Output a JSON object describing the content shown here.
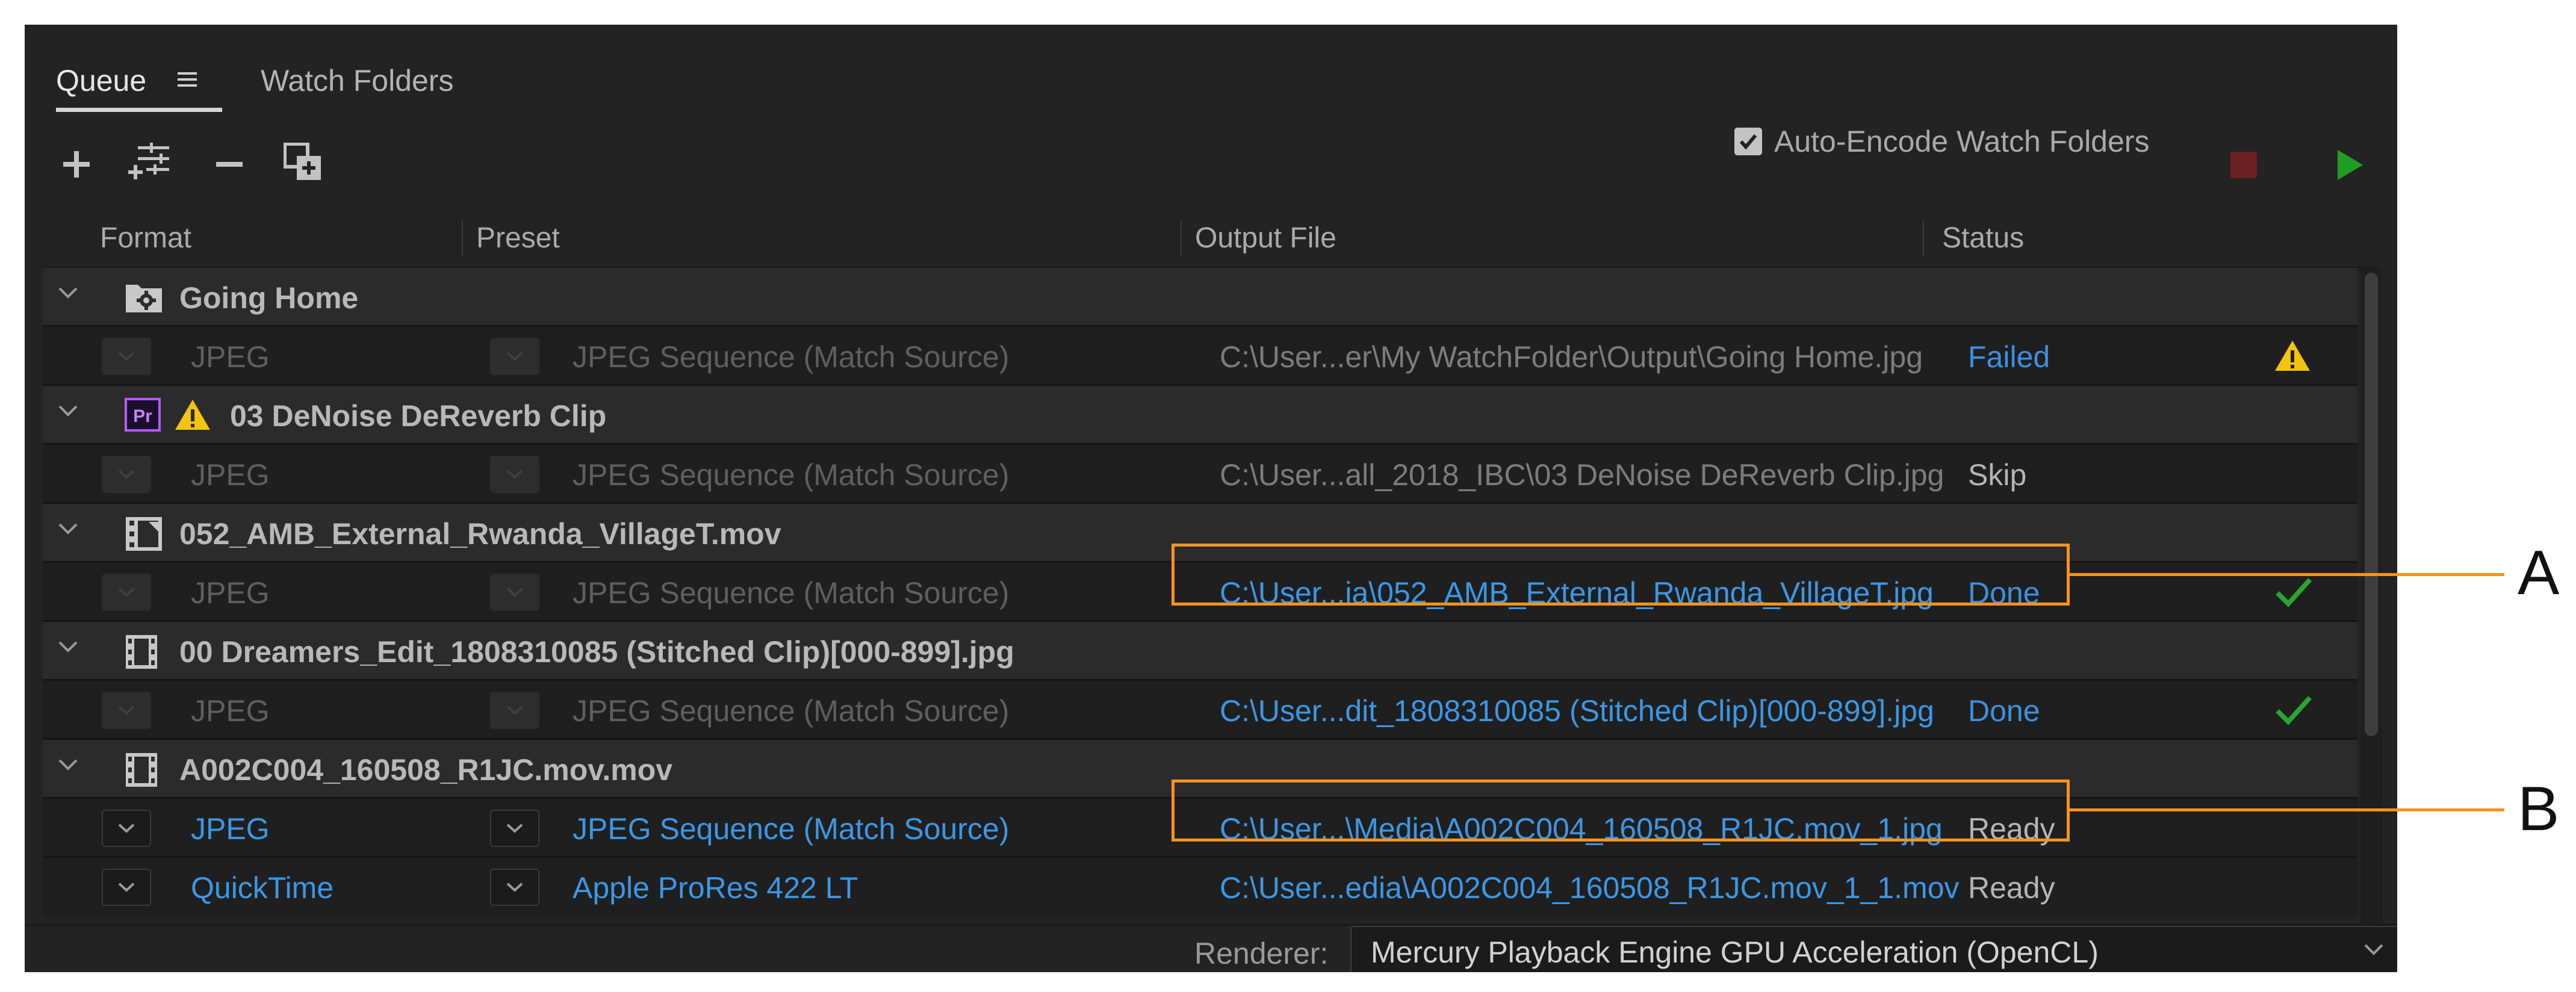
{
  "tabs": [
    {
      "label": "Queue",
      "active": true
    },
    {
      "label": "Watch Folders",
      "active": false
    }
  ],
  "tab_menu_icon": "hamburger-icon",
  "toolbar": {
    "icons": [
      "add-icon",
      "preset-settings-icon",
      "remove-icon",
      "duplicate-icon"
    ],
    "auto_encode_label": "Auto-Encode Watch Folders",
    "auto_encode_checked": true,
    "stop_icon": "stop-icon",
    "play_icon": "play-icon",
    "play_color": "#1f9d23",
    "stop_color": "#6b2020"
  },
  "columns": [
    "Format",
    "Preset",
    "Output File",
    "Status"
  ],
  "groups": [
    {
      "name": "Going Home",
      "icon": "watch-folder-icon",
      "warning": false,
      "items": [
        {
          "format": "JPEG",
          "preset": "JPEG Sequence (Match Source)",
          "output": "C:\\User...er\\My WatchFolder\\Output\\Going Home.jpg",
          "status": "Failed",
          "status_icon": "warning-icon"
        }
      ]
    },
    {
      "name": "03 DeNoise DeReverb Clip",
      "icon": "premiere-pro-icon",
      "warning": true,
      "items": [
        {
          "format": "JPEG",
          "preset": "JPEG Sequence (Match Source)",
          "output": "C:\\User...all_2018_IBC\\03 DeNoise DeReverb Clip.jpg",
          "status": "Skip",
          "status_icon": ""
        }
      ]
    },
    {
      "name": "052_AMB_External_Rwanda_VillageT.mov",
      "icon": "clip-icon",
      "warning": false,
      "items": [
        {
          "format": "JPEG",
          "preset": "JPEG Sequence (Match Source)",
          "output": "C:\\User...ia\\052_AMB_External_Rwanda_VillageT.jpg",
          "status": "Done",
          "status_icon": "checkmark-icon"
        }
      ]
    },
    {
      "name": "00 Dreamers_Edit_1808310085 (Stitched Clip)[000-899].jpg",
      "icon": "film-icon",
      "warning": false,
      "items": [
        {
          "format": "JPEG",
          "preset": "JPEG Sequence (Match Source)",
          "output": "C:\\User...dit_1808310085 (Stitched Clip)[000-899].jpg",
          "status": "Done",
          "status_icon": "checkmark-icon"
        }
      ]
    },
    {
      "name": "A002C004_160508_R1JC.mov.mov",
      "icon": "film-icon",
      "warning": false,
      "items": [
        {
          "format": "JPEG",
          "preset": "JPEG Sequence (Match Source)",
          "output": "C:\\User...\\Media\\A002C004_160508_R1JC.mov_1.jpg",
          "status": "Ready",
          "status_icon": ""
        },
        {
          "format": "QuickTime",
          "preset": "Apple ProRes 422 LT",
          "output": "C:\\User...edia\\A002C004_160508_R1JC.mov_1_1.mov",
          "status": "Ready",
          "status_icon": ""
        }
      ]
    }
  ],
  "footer": {
    "renderer_label": "Renderer:",
    "renderer_value": "Mercury Playback Engine GPU Acceleration (OpenCL)"
  },
  "callouts": {
    "a": "A",
    "b": "B"
  },
  "colors": {
    "accent_blue": "#3c97e6",
    "callout_orange": "#f7941d",
    "warning_yellow": "#f2c40f",
    "done_green": "#2aa52f"
  }
}
